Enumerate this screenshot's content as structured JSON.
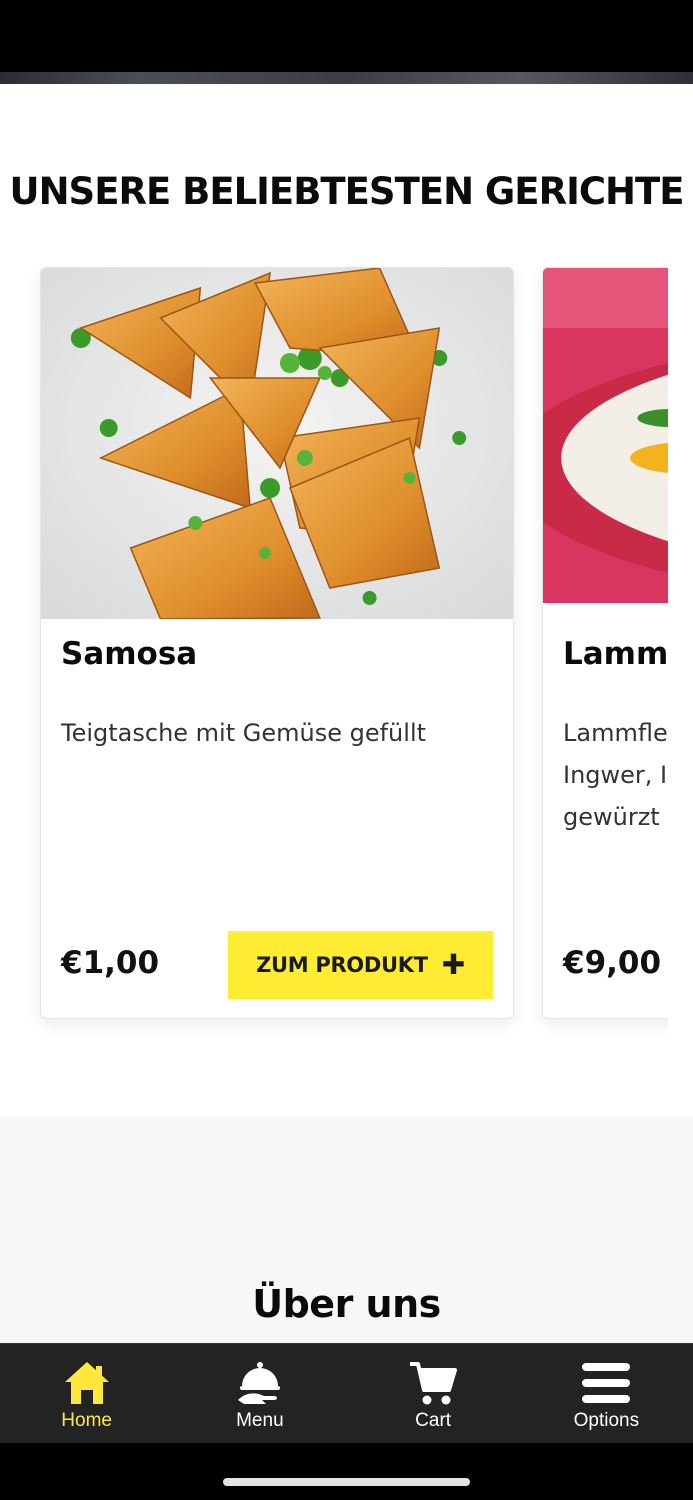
{
  "section": {
    "title": "UNSERE BELIEBTESTEN GERICHTE"
  },
  "products": [
    {
      "name": "Samosa",
      "description": "Teigtasche mit Gemüse gefüllt",
      "price": "€1,00",
      "cta_label": "ZUM PRODUKT",
      "cta_icon": "plus-icon"
    },
    {
      "name": "Lamm",
      "description": "Lammfle\nIngwer, I\ngewürzt",
      "price": "€9,00"
    }
  ],
  "about": {
    "title": "Über uns"
  },
  "bottom_nav": {
    "items": [
      {
        "label": "Home",
        "icon": "home-icon",
        "active": true
      },
      {
        "label": "Menu",
        "icon": "food-service-icon",
        "active": false
      },
      {
        "label": "Cart",
        "icon": "cart-icon",
        "active": false
      },
      {
        "label": "Options",
        "icon": "menu-bars-icon",
        "active": false
      }
    ]
  },
  "colors": {
    "accent_yellow": "#ffec33",
    "active_nav": "#ffe83b",
    "nav_background": "#232323"
  }
}
